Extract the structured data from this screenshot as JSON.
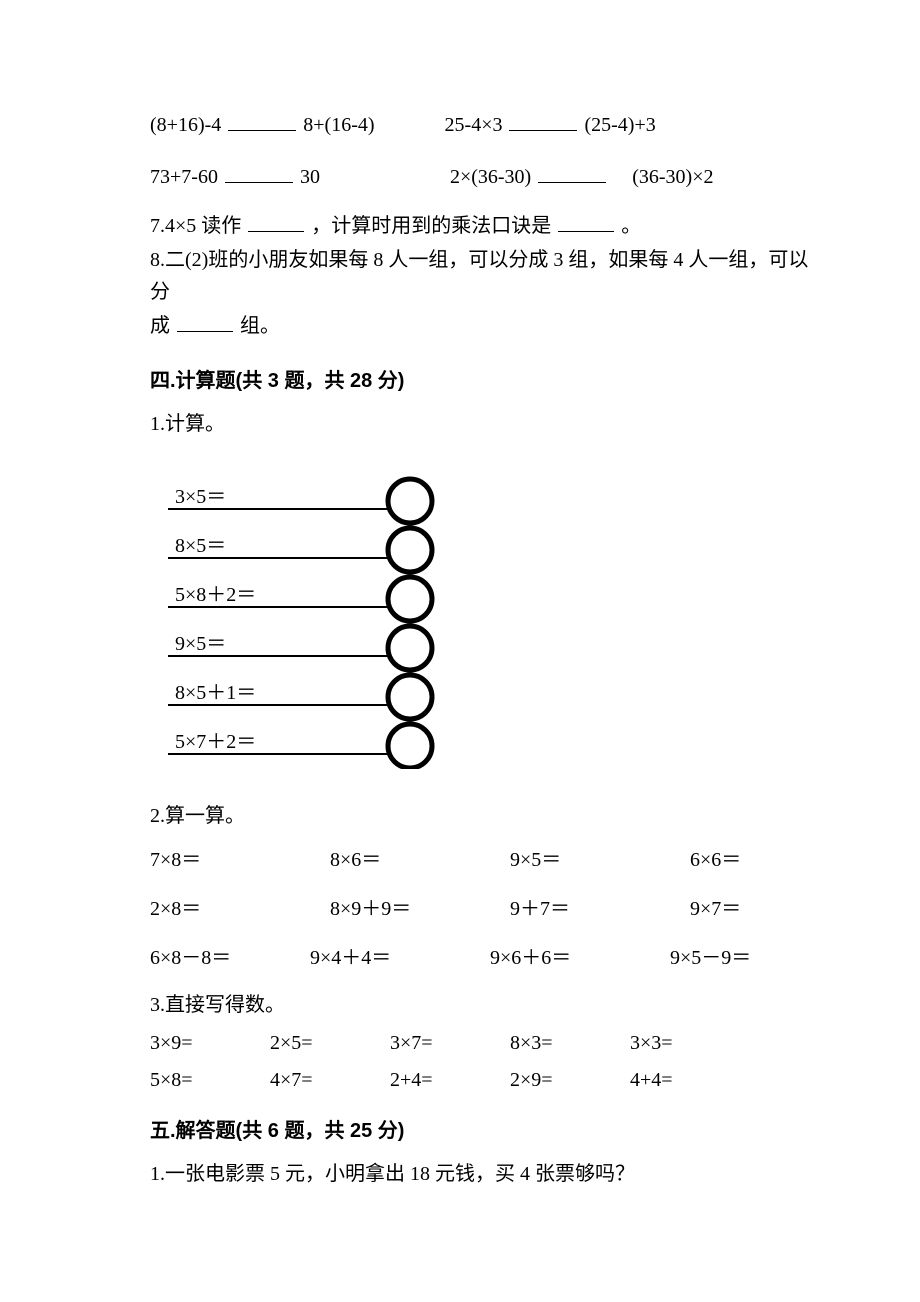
{
  "compare": {
    "row1": {
      "lhs": "(8+16)-4",
      "rhs": "8+(16-4)",
      "lhs2": "25-4×3",
      "rhs2": "(25-4)+3"
    },
    "row2": {
      "lhs": "73+7-60",
      "rhs": "30",
      "lhs2": "2×(36-30)",
      "rhs2": "(36-30)×2"
    }
  },
  "fill7": {
    "prefix": "7.4×5 读作",
    "mid": "，计算时用到的乘法口诀是",
    "suffix": "。"
  },
  "fill8": {
    "text_a": "8.二(2)班的小朋友如果每 8 人一组，可以分成 3 组，如果每 4 人一组，可以分",
    "text_b": "成",
    "text_c": "组。"
  },
  "sec4": {
    "title": "四.计算题(共 3 题，共 28 分)",
    "q1": "1.计算。"
  },
  "bubble_items": [
    "3×5＝",
    "8×5＝",
    "5×8＋2＝",
    "9×5＝",
    "8×5＋1＝",
    "5×7＋2＝"
  ],
  "q2": {
    "label": "2.算一算。",
    "r1": [
      "7×8＝",
      "8×6＝",
      "9×5＝",
      "6×6＝"
    ],
    "r2": [
      "2×8＝",
      "8×9＋9＝",
      "9＋7＝",
      "9×7＝"
    ],
    "r3": [
      "6×8－8＝",
      "9×4＋4＝",
      "9×6＋6＝",
      "9×5－9＝"
    ]
  },
  "q3": {
    "label": "3.直接写得数。",
    "r1": [
      "3×9=",
      "2×5=",
      "3×7=",
      "8×3=",
      "3×3="
    ],
    "r2": [
      "5×8=",
      "4×7=",
      "2+4=",
      "2×9=",
      "4+4="
    ]
  },
  "sec5": {
    "title": "五.解答题(共 6 题，共 25 分)",
    "q1": "1.一张电影票 5 元，小明拿出 18 元钱，买 4 张票够吗？"
  }
}
